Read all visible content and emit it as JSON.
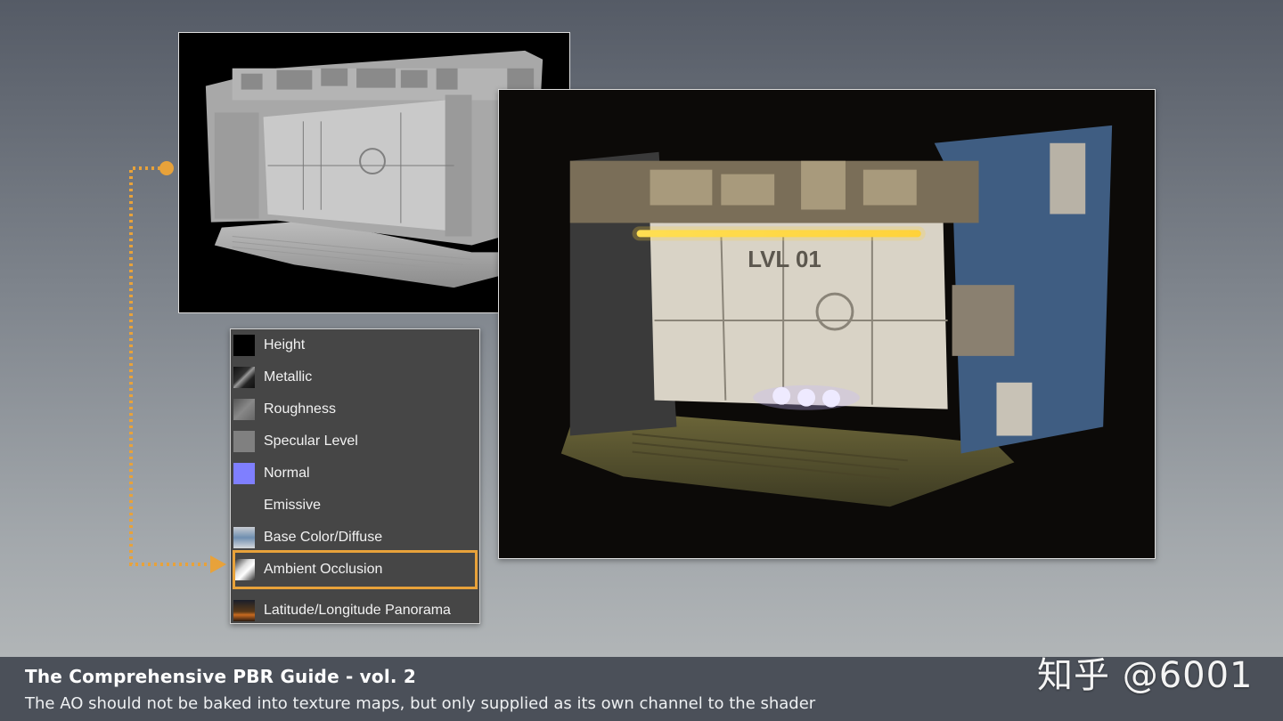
{
  "slide": {
    "title": "The Comprehensive PBR Guide - vol. 2",
    "subtitle": "The AO should not be baked into texture maps, but only supplied as its own channel to the shader"
  },
  "watermark": "知乎 @6001",
  "render_ao": {
    "description_icon": "ambient-occlusion-render"
  },
  "render_pbr": {
    "sign_text": "LVL 01"
  },
  "channels": [
    {
      "label": "Height",
      "thumb_color": "#000000"
    },
    {
      "label": "Metallic",
      "thumb_color": "#1a1a1a"
    },
    {
      "label": "Roughness",
      "thumb_color": "#6a6a6a"
    },
    {
      "label": "Specular Level",
      "thumb_color": "#808080"
    },
    {
      "label": "Normal",
      "thumb_color": "#8080ff"
    },
    {
      "label": "Emissive",
      "thumb_color": "#464646"
    },
    {
      "label": "Base Color/Diffuse",
      "thumb_color": "#c9ccd0"
    },
    {
      "label": "Ambient Occlusion",
      "thumb_color": "#dcdcdc",
      "selected": true
    },
    {
      "label": "Latitude/Longitude Panorama",
      "thumb_color": "#3a2a1a"
    }
  ],
  "colors": {
    "highlight": "#e8a23a",
    "footer": "#4b5059"
  }
}
